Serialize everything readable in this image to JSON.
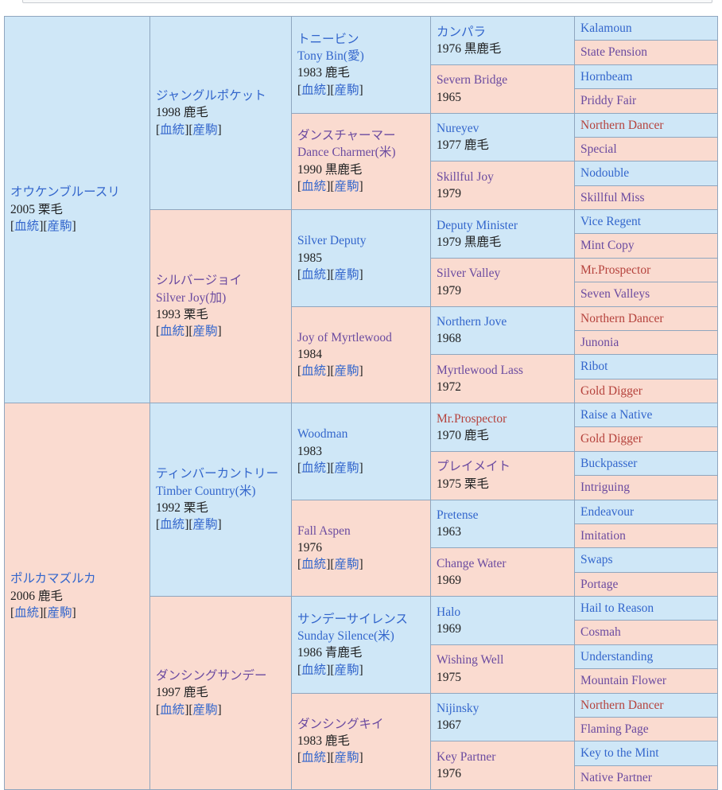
{
  "page": {
    "title": "オウケンブルースリ 血統表",
    "colors": {
      "sire_bg": "#cfe7f7",
      "dam_bg": "#fadbd0",
      "border": "#8fa6bf",
      "link": "#3366cc",
      "link_visited": "#6b4ba0",
      "link_inbred": "#b5423c"
    },
    "link_labels": {
      "pedigree": "血統",
      "offspring": "産駒",
      "open": "[",
      "close": "]"
    }
  },
  "pedigree": {
    "gen1": [
      {
        "name_ja": "オウケンブルースリ",
        "name_en": "",
        "meta": "2005 栗毛",
        "sex": "m",
        "links": true
      },
      {
        "name_ja": "ポルカマズルカ",
        "name_en": "",
        "meta": "2006 鹿毛",
        "sex": "f",
        "links": true
      }
    ],
    "gen2": [
      {
        "name_ja": "ジャングルポケット",
        "name_en": "",
        "meta": "1998 鹿毛",
        "sex": "m",
        "links": true,
        "color": "link"
      },
      {
        "name_ja": "シルバージョイ",
        "name_en": "Silver Joy(加)",
        "meta": "1993 栗毛",
        "sex": "f",
        "links": true,
        "color": "link_visited"
      },
      {
        "name_ja": "ティンバーカントリー",
        "name_en": "Timber Country(米)",
        "meta": "1992 栗毛",
        "sex": "m",
        "links": true,
        "color": "link"
      },
      {
        "name_ja": "ダンシングサンデー",
        "name_en": "",
        "meta": "1997 鹿毛",
        "sex": "f",
        "links": true,
        "color": "link_visited"
      }
    ],
    "gen3": [
      {
        "name_ja": "トニービン",
        "name_en": "Tony Bin(愛)",
        "meta": "1983 鹿毛",
        "sex": "m",
        "links": true,
        "color": "link"
      },
      {
        "name_ja": "ダンスチャーマー",
        "name_en": "Dance Charmer(米)",
        "meta": "1990 黒鹿毛",
        "sex": "f",
        "links": true,
        "color": "link_visited"
      },
      {
        "name_ja": "",
        "name_en": "Silver Deputy",
        "meta": "1985",
        "sex": "m",
        "links": true,
        "color": "link"
      },
      {
        "name_ja": "",
        "name_en": "Joy of Myrtlewood",
        "meta": "1984",
        "sex": "f",
        "links": true,
        "color": "link_visited"
      },
      {
        "name_ja": "",
        "name_en": "Woodman",
        "meta": "1983",
        "sex": "m",
        "links": true,
        "color": "link"
      },
      {
        "name_ja": "",
        "name_en": "Fall Aspen",
        "meta": "1976",
        "sex": "f",
        "links": true,
        "color": "link_visited"
      },
      {
        "name_ja": "サンデーサイレンス",
        "name_en": "Sunday Silence(米)",
        "meta": "1986 青鹿毛",
        "sex": "m",
        "links": true,
        "color": "link"
      },
      {
        "name_ja": "ダンシングキイ",
        "name_en": "",
        "meta": "1983 鹿毛",
        "sex": "f",
        "links": true,
        "color": "link_visited"
      }
    ],
    "gen4": [
      {
        "name_ja": "カンパラ",
        "name_en": "",
        "meta": "1976 黒鹿毛",
        "sex": "m",
        "color": "link"
      },
      {
        "name_ja": "",
        "name_en": "Severn Bridge",
        "meta": "1965",
        "sex": "f",
        "color": "link_visited"
      },
      {
        "name_ja": "",
        "name_en": "Nureyev",
        "meta": "1977 鹿毛",
        "sex": "m",
        "color": "link"
      },
      {
        "name_ja": "",
        "name_en": "Skillful Joy",
        "meta": "1979",
        "sex": "f",
        "color": "link_visited"
      },
      {
        "name_ja": "",
        "name_en": "Deputy Minister",
        "meta": "1979 黒鹿毛",
        "sex": "m",
        "color": "link"
      },
      {
        "name_ja": "",
        "name_en": "Silver Valley",
        "meta": "1979",
        "sex": "f",
        "color": "link_visited"
      },
      {
        "name_ja": "",
        "name_en": "Northern Jove",
        "meta": "1968",
        "sex": "m",
        "color": "link"
      },
      {
        "name_ja": "",
        "name_en": "Myrtlewood Lass",
        "meta": "1972",
        "sex": "f",
        "color": "link_visited"
      },
      {
        "name_ja": "",
        "name_en": "Mr.Prospector",
        "meta": "1970 鹿毛",
        "sex": "m",
        "color": "link_inbred"
      },
      {
        "name_ja": "プレイメイト",
        "name_en": "",
        "meta": "1975 栗毛",
        "sex": "f",
        "color": "link_visited"
      },
      {
        "name_ja": "",
        "name_en": "Pretense",
        "meta": "1963",
        "sex": "m",
        "color": "link"
      },
      {
        "name_ja": "",
        "name_en": "Change Water",
        "meta": "1969",
        "sex": "f",
        "color": "link_visited"
      },
      {
        "name_ja": "",
        "name_en": "Halo",
        "meta": "1969",
        "sex": "m",
        "color": "link"
      },
      {
        "name_ja": "",
        "name_en": "Wishing Well",
        "meta": "1975",
        "sex": "f",
        "color": "link_visited"
      },
      {
        "name_ja": "",
        "name_en": "Nijinsky",
        "meta": "1967",
        "sex": "m",
        "color": "link"
      },
      {
        "name_ja": "",
        "name_en": "Key Partner",
        "meta": "1976",
        "sex": "f",
        "color": "link_visited"
      }
    ],
    "gen5": [
      {
        "name": "Kalamoun",
        "sex": "m",
        "color": "link"
      },
      {
        "name": "State Pension",
        "sex": "f",
        "color": "link_visited"
      },
      {
        "name": "Hornbeam",
        "sex": "m",
        "color": "link"
      },
      {
        "name": "Priddy Fair",
        "sex": "f",
        "color": "link_visited"
      },
      {
        "name": "Northern Dancer",
        "sex": "m",
        "color": "link_inbred"
      },
      {
        "name": "Special",
        "sex": "f",
        "color": "link_visited"
      },
      {
        "name": "Nodouble",
        "sex": "m",
        "color": "link"
      },
      {
        "name": "Skillful Miss",
        "sex": "f",
        "color": "link_visited"
      },
      {
        "name": "Vice Regent",
        "sex": "m",
        "color": "link"
      },
      {
        "name": "Mint Copy",
        "sex": "f",
        "color": "link_visited"
      },
      {
        "name": "Mr.Prospector",
        "sex": "f",
        "color": "link_inbred"
      },
      {
        "name": "Seven Valleys",
        "sex": "f",
        "color": "link_visited"
      },
      {
        "name": "Northern Dancer",
        "sex": "f",
        "color": "link_inbred"
      },
      {
        "name": "Junonia",
        "sex": "f",
        "color": "link_visited"
      },
      {
        "name": "Ribot",
        "sex": "m",
        "color": "link"
      },
      {
        "name": "Gold Digger",
        "sex": "f",
        "color": "link_inbred"
      },
      {
        "name": "Raise a Native",
        "sex": "m",
        "color": "link"
      },
      {
        "name": "Gold Digger",
        "sex": "f",
        "color": "link_inbred"
      },
      {
        "name": "Buckpasser",
        "sex": "m",
        "color": "link"
      },
      {
        "name": "Intriguing",
        "sex": "f",
        "color": "link_visited"
      },
      {
        "name": "Endeavour",
        "sex": "m",
        "color": "link"
      },
      {
        "name": "Imitation",
        "sex": "f",
        "color": "link_visited"
      },
      {
        "name": "Swaps",
        "sex": "m",
        "color": "link"
      },
      {
        "name": "Portage",
        "sex": "f",
        "color": "link_visited"
      },
      {
        "name": "Hail to Reason",
        "sex": "m",
        "color": "link"
      },
      {
        "name": "Cosmah",
        "sex": "f",
        "color": "link_visited"
      },
      {
        "name": "Understanding",
        "sex": "m",
        "color": "link"
      },
      {
        "name": "Mountain Flower",
        "sex": "f",
        "color": "link_visited"
      },
      {
        "name": "Northern Dancer",
        "sex": "m",
        "color": "link_inbred"
      },
      {
        "name": "Flaming Page",
        "sex": "f",
        "color": "link_visited"
      },
      {
        "name": "Key to the Mint",
        "sex": "m",
        "color": "link"
      },
      {
        "name": "Native Partner",
        "sex": "f",
        "color": "link_visited"
      }
    ]
  }
}
